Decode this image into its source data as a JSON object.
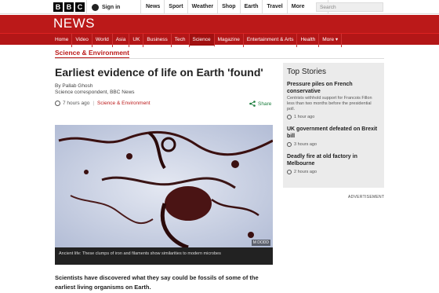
{
  "brand": {
    "logo_letters": [
      "B",
      "B",
      "C"
    ],
    "news_title": "NEWS"
  },
  "account": {
    "sign_in": "Sign in"
  },
  "top_nav": [
    "News",
    "Sport",
    "Weather",
    "Shop",
    "Earth",
    "Travel",
    "More"
  ],
  "search": {
    "placeholder": "Search"
  },
  "section_nav": [
    "Home",
    "Video",
    "World",
    "Asia",
    "UK",
    "Business",
    "Tech",
    "Science",
    "Magazine",
    "Entertainment & Arts",
    "Health",
    "More"
  ],
  "active_section": "Science",
  "section_title": "Science & Environment",
  "article": {
    "headline": "Earliest evidence of life on Earth 'found'",
    "author": "By Pallab Ghosh",
    "role": "Science correspondent, BBC News",
    "time": "7 hours ago",
    "category": "Science & Environment",
    "share": "Share",
    "image_credit": "M DODD",
    "caption": "Ancient life: These clumps of iron and filaments show similarities to modern microbes",
    "lead": "Scientists have discovered what they say could be fossils of some of the earliest living organisms on Earth."
  },
  "top_stories": {
    "heading": "Top Stories",
    "items": [
      {
        "title": "Pressure piles on French conservative",
        "summary": "Centrists withhold support for Francois Fillon less than two months before the presidential poll.",
        "time": "1 hour ago"
      },
      {
        "title": "UK government defeated on Brexit bill",
        "summary": "",
        "time": "3 hours ago"
      },
      {
        "title": "Deadly fire at old factory in Melbourne",
        "summary": "",
        "time": "2 hours ago"
      }
    ]
  },
  "advertisement_label": "ADVERTISEMENT",
  "colors": {
    "brand_red": "#bb1919",
    "share_green": "#1a7d3c"
  }
}
